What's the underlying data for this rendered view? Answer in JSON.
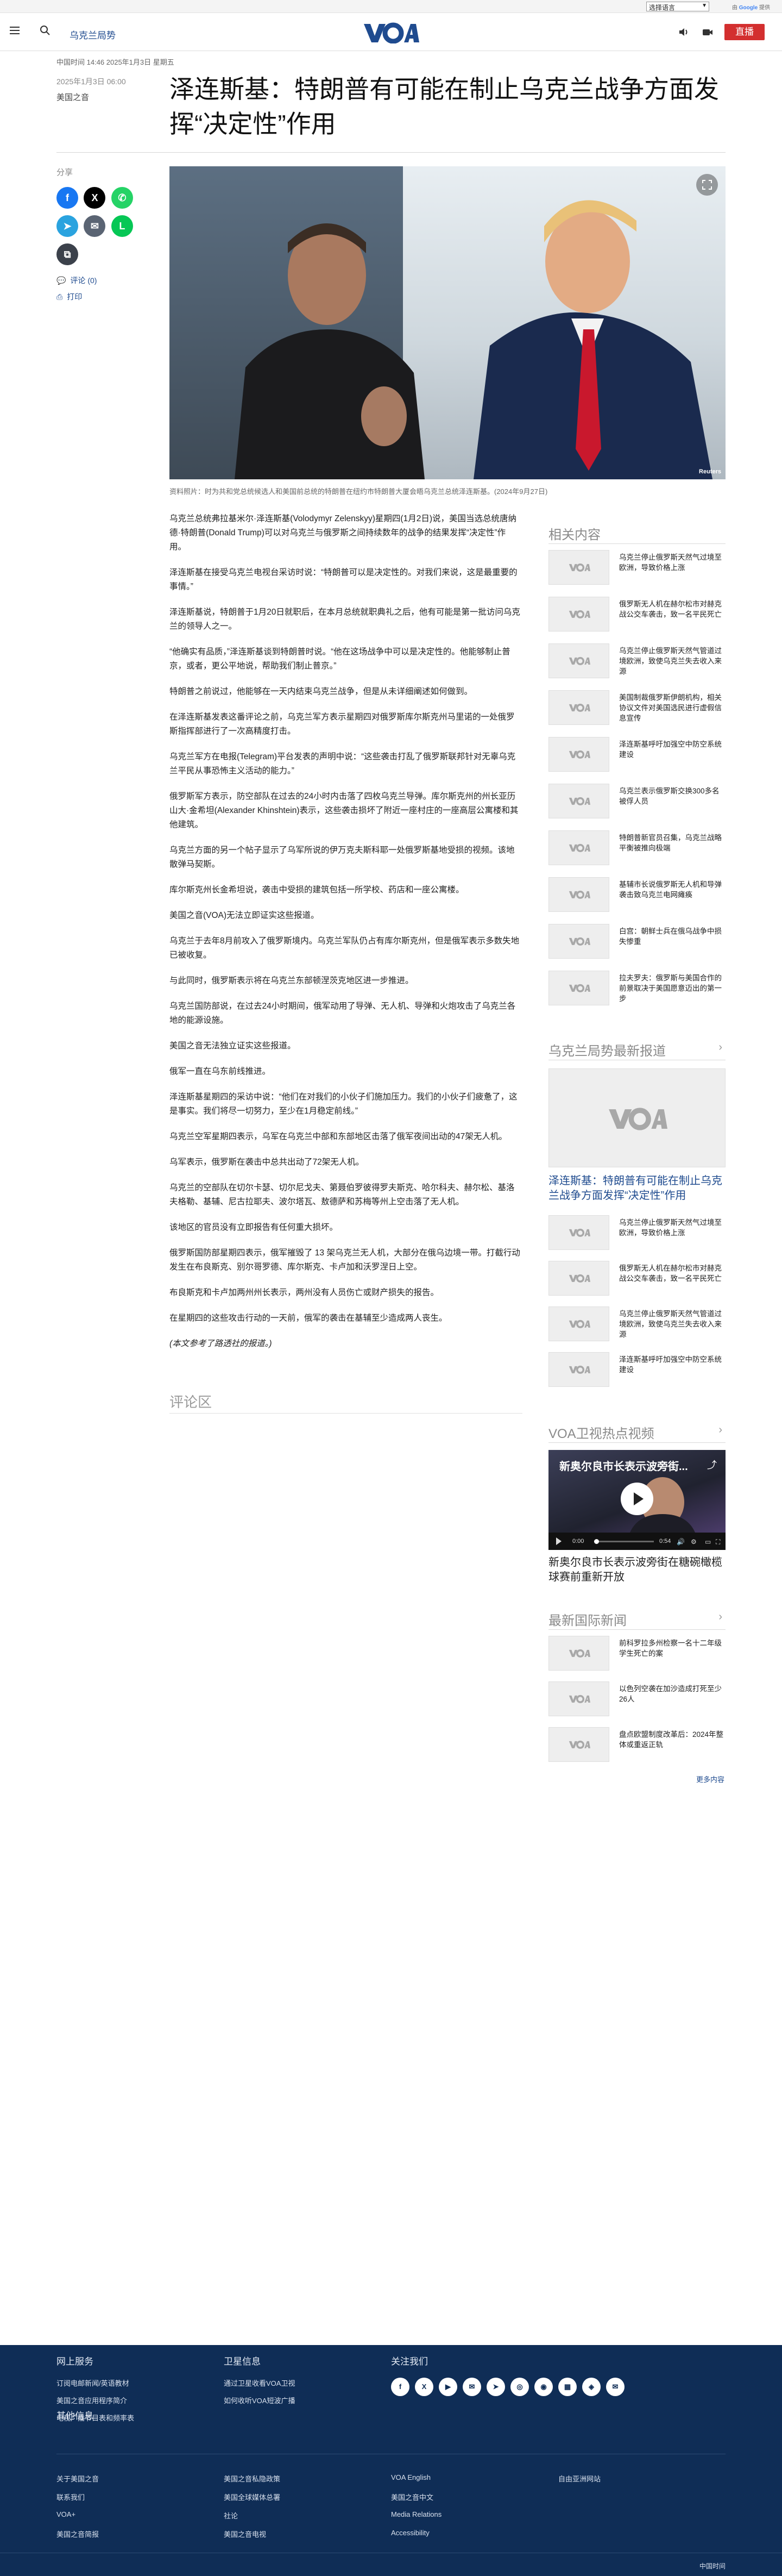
{
  "topbar": {
    "language_select": "选择语言",
    "powered_by_prefix": "由",
    "powered_by_brand": "Google",
    "powered_by_suffix": "提供"
  },
  "header": {
    "section": "乌克兰局势",
    "live_label": "直播",
    "brand_color": "#1f4b8f",
    "live_color": "#d32f2f"
  },
  "article": {
    "meta_time": "中国时间 14:46 2025年1月3日 星期五",
    "pubdate": "2025年1月3日 06:00",
    "authors": "美国之音",
    "headline": "泽连斯基：特朗普有可能在制止乌克兰战争方面发挥“决定性”作用",
    "share_label": "分享",
    "comments_link": "评论 (0)",
    "print_link": "打印",
    "caption": "资料照片：时为共和党总统候选人和美国前总统的特朗普在纽约市特朗普大厦会晤乌克兰总统泽连斯基。(2024年9月27日)",
    "image_credit": "Reuters",
    "paragraphs": [
      "乌克兰总统弗拉基米尔·泽连斯基(Volodymyr Zelenskyy)星期四(1月2日)说，美国当选总统唐纳德·特朗普(Donald Trump)可以对乌克兰与俄罗斯之间持续数年的战争的结果发挥“决定性”作用。",
      "泽连斯基在接受乌克兰电视台采访时说：“特朗普可以是决定性的。对我们来说，这是最重要的事情。”",
      "泽连斯基说，特朗普于1月20日就职后，在本月总统就职典礼之后，他有可能是第一批访问乌克兰的领导人之一。",
      "“他确实有品质，”泽连斯基谈到特朗普时说。“他在这场战争中可以是决定性的。他能够制止普京，或者，更公平地说，帮助我们制止普京。”",
      "特朗普之前说过，他能够在一天内结束乌克兰战争，但是从未详细阐述如何做到。",
      "在泽连斯基发表这番评论之前，乌克兰军方表示星期四对俄罗斯库尔斯克州马里诺的一处俄罗斯指挥部进行了一次高精度打击。",
      "乌克兰军方在电报(Telegram)平台发表的声明中说：“这些袭击打乱了俄罗斯联邦针对无辜乌克兰平民从事恐怖主义活动的能力。”",
      "俄罗斯军方表示，防空部队在过去的24小时内击落了四枚乌克兰导弹。库尔斯克州的州长亚历山大·金希坦(Alexander Khinshtein)表示，这些袭击损坏了附近一座村庄的一座高层公寓楼和其他建筑。",
      "乌克兰方面的另一个帖子显示了乌军所说的伊万克夫斯科耶一处俄罗斯基地受损的视频。该地散弹马契斯。",
      "库尔斯克州长金希坦说，袭击中受损的建筑包括一所学校、药店和一座公寓楼。",
      "美国之音(VOA)无法立即证实这些报道。",
      "乌克兰于去年8月前攻入了俄罗斯境内。乌克兰军队仍占有库尔斯克州，但是俄军表示多数失地已被收复。",
      "与此同时，俄罗斯表示将在乌克兰东部顿涅茨克地区进一步推进。",
      "乌克兰国防部说，在过去24小时期间，俄军动用了导弹、无人机、导弹和火炮攻击了乌克兰各地的能源设施。",
      "美国之音无法独立证实这些报道。",
      "俄军一直在乌东前线推进。",
      "泽连斯基星期四的采访中说：“他们在对我们的小伙子们施加压力。我们的小伙子们疲惫了，这是事实。我们将尽一切努力，至少在1月稳定前线。”",
      "乌克兰空军星期四表示，乌军在乌克兰中部和东部地区击落了俄军夜间出动的47架无人机。",
      "乌军表示，俄罗斯在袭击中总共出动了72架无人机。",
      "乌克兰的空部队在切尔卡瑟、切尔尼戈夫、第聂伯罗彼得罗夫斯克、哈尔科夫、赫尔松、基洛夫格勒、基辅、尼古拉耶夫、波尔塔瓦、敖德萨和苏梅等州上空击落了无人机。",
      "该地区的官员没有立即报告有任何重大损坏。",
      "俄罗斯国防部星期四表示，俄军摧毁了 13 架乌克兰无人机，大部分在俄乌边境一带。打截行动发生在布良斯克、别尔哥罗德、库尔斯克、卡卢加和沃罗涅日上空。",
      "布良斯克和卡卢加两州州长表示，两州没有人员伤亡或财产损失的报告。",
      "在星期四的这些攻击行动的一天前，俄军的袭击在基辅至少造成两人丧生。",
      "(本文参考了路透社的报道。)"
    ],
    "comments_title": "评论区"
  },
  "sidebar": {
    "related_title": "相关内容",
    "related": [
      "乌克兰停止俄罗斯天然气过境至欧洲，导致价格上涨",
      "俄罗斯无人机在赫尔松市对赫克战公交车袭击，致一名平民死亡",
      "乌克兰停止俄罗斯天然气管道过境欧洲，致使乌克兰失去收入来源",
      "美国制裁俄罗斯伊朗机构，相关协议文件对美国选民进行虚假信息宣传",
      "泽连斯基呼吁加强空中防空系统建设",
      "乌克兰表示俄罗斯交换300多名被俘人员",
      "特朗普新官员召集，乌克兰战略平衡被推向极端",
      "基辅市长说俄罗斯无人机和导弹袭击致乌克兰电网瘫痪",
      "白宫：朝鲜士兵在俄乌战争中损失惨重",
      "拉夫罗夫：俄罗斯与美国合作的前景取决于美国愿意迈出的第一步"
    ],
    "latest_title": "乌克兰局势最新报道",
    "featured_title": "泽连斯基：特朗普有可能在制止乌克兰战争方面发挥“决定性”作用",
    "latest": [
      "乌克兰停止俄罗斯天然气过境至欧洲，导致价格上涨",
      "俄罗斯无人机在赫尔松市对赫克战公交车袭击，致一名平民死亡",
      "乌克兰停止俄罗斯天然气管道过境欧洲，致使乌克兰失去收入来源",
      "泽连斯基呼吁加强空中防空系统建设"
    ],
    "video_section_title": "VOA卫视热点视频",
    "video_overlay_title": "新奥尔良市长表示波旁街...",
    "video_time_current": "0:00",
    "video_time_total": "0:54",
    "video_caption": "新奥尔良市长表示波旁街在糖碗橄榄球赛前重新开放",
    "intl_title": "最新国际新闻",
    "intl": [
      "前科罗拉多州检察一名十二年级学生死亡的案",
      "以色列空袭在加沙造成打死至少26人",
      "盘点欧盟制度改革后：2024年整体或重返正轨"
    ],
    "more_link": "更多内容"
  },
  "footer": {
    "col1_title": "网上服务",
    "col1_links": [
      "订阅电邮新闻/英语教材",
      "美国之音应用程序简介",
      "电视广播节目表和频率表"
    ],
    "col2_title": "卫星信息",
    "col2_links": [
      "通过卫星收看VOA卫视",
      "如何收听VOA短波广播"
    ],
    "col3_title": "关注我们",
    "social": [
      "f",
      "X",
      "▶",
      "✉",
      "➤",
      "◎",
      "◉",
      "▦",
      "◈",
      "✉"
    ],
    "other_title": "其他信息",
    "other_links": [
      [
        "关于美国之音",
        "美国之音私隐政策",
        "VOA English",
        "自由亚洲网站"
      ],
      [
        "联系我们",
        "美国全球媒体总署",
        "美国之音中文",
        ""
      ],
      [
        "VOA+",
        "社论",
        "Media Relations",
        ""
      ],
      [
        "美国之音简报",
        "美国之音电视",
        "Accessibility",
        ""
      ]
    ],
    "copyright": "中国时间"
  }
}
